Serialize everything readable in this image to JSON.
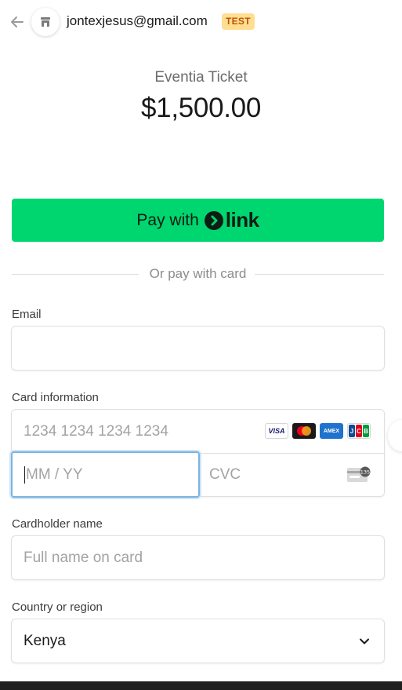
{
  "header": {
    "merchant_email": "jontexjesus@gmail.com",
    "badge": "TEST"
  },
  "summary": {
    "product_name": "Eventia Ticket",
    "price": "$1,500.00"
  },
  "link_button": {
    "label": "Pay with",
    "brand": "link",
    "color": "#00d66f"
  },
  "divider": {
    "label": "Or pay with card"
  },
  "email": {
    "label": "Email",
    "value": ""
  },
  "card": {
    "label": "Card information",
    "number_placeholder": "1234 1234 1234 1234",
    "expiry_placeholder": "MM / YY",
    "cvc_placeholder": "CVC",
    "brands": [
      "VISA",
      "mastercard",
      "AMEX",
      "JCB"
    ],
    "cvc_icon_text": "135"
  },
  "cardholder": {
    "label": "Cardholder name",
    "placeholder": "Full name on card"
  },
  "country": {
    "label": "Country or region",
    "selected": "Kenya"
  },
  "icons": {
    "back": "arrow-left-icon",
    "merchant": "store-icon",
    "chevron": "chevron-down-icon"
  }
}
